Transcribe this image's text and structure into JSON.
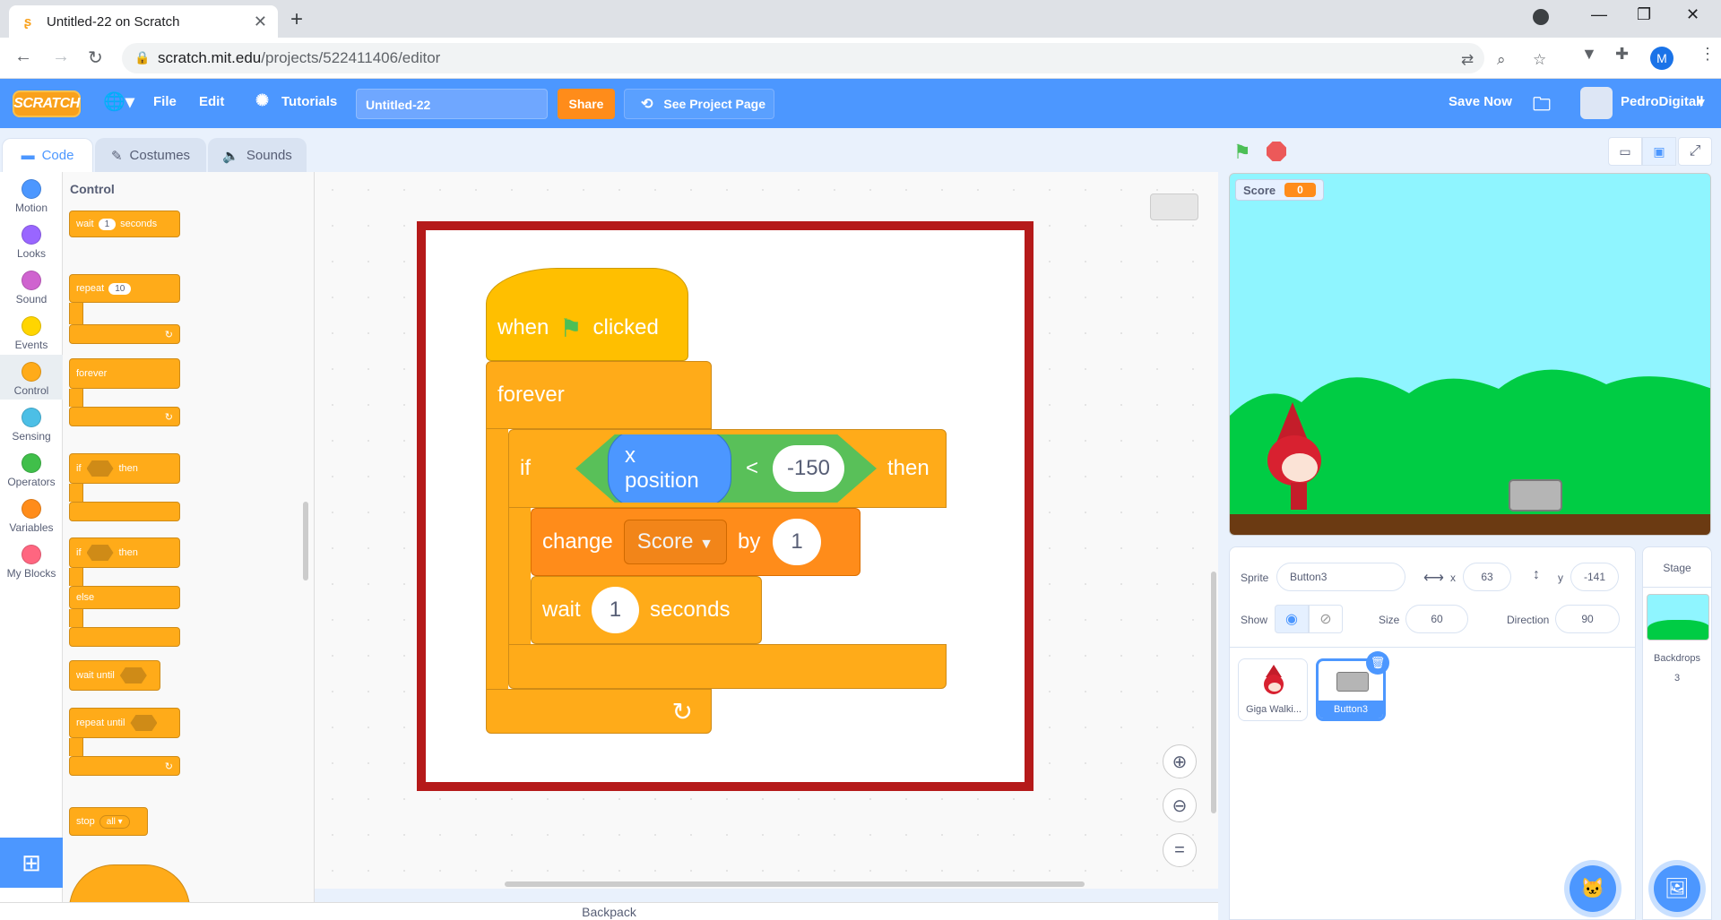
{
  "browser": {
    "tab_title": "Untitled-22 on Scratch",
    "url_host": "scratch.mit.edu",
    "url_path": "/projects/522411406/editor",
    "profile_initial": "M"
  },
  "menu": {
    "logo": "SCRATCH",
    "file": "File",
    "edit": "Edit",
    "tutorials": "Tutorials",
    "project_title": "Untitled-22",
    "share": "Share",
    "see_project": "See Project Page",
    "save_now": "Save Now",
    "username": "PedroDigitall"
  },
  "tabs": {
    "code": "Code",
    "costumes": "Costumes",
    "sounds": "Sounds"
  },
  "categories": [
    {
      "label": "Motion",
      "color": "#4c97ff"
    },
    {
      "label": "Looks",
      "color": "#9966ff"
    },
    {
      "label": "Sound",
      "color": "#cf63cf"
    },
    {
      "label": "Events",
      "color": "#ffd500"
    },
    {
      "label": "Control",
      "color": "#ffab19"
    },
    {
      "label": "Sensing",
      "color": "#4cbfe6"
    },
    {
      "label": "Operators",
      "color": "#40bf4a"
    },
    {
      "label": "Variables",
      "color": "#ff8c1a"
    },
    {
      "label": "My Blocks",
      "color": "#ff6680"
    }
  ],
  "palette": {
    "heading": "Control",
    "wait": "wait",
    "wait_val": "1",
    "seconds": "seconds",
    "repeat": "repeat",
    "repeat_val": "10",
    "forever": "forever",
    "if": "if",
    "then": "then",
    "else": "else",
    "wait_until": "wait until",
    "repeat_until": "repeat until",
    "stop": "stop",
    "stop_val": "all"
  },
  "script": {
    "when": "when",
    "clicked": "clicked",
    "forever": "forever",
    "if": "if",
    "then": "then",
    "x_position": "x position",
    "lt": "<",
    "compare_val": "-150",
    "change": "change",
    "variable": "Score",
    "by": "by",
    "change_val": "1",
    "wait": "wait",
    "wait_val": "1",
    "seconds": "seconds"
  },
  "backpack": "Backpack",
  "stage": {
    "monitor_label": "Score",
    "monitor_value": "0"
  },
  "sprite_info": {
    "sprite_label": "Sprite",
    "sprite_name": "Button3",
    "x_label": "x",
    "x": "63",
    "y_label": "y",
    "y": "-141",
    "show_label": "Show",
    "size_label": "Size",
    "size": "60",
    "direction_label": "Direction",
    "direction": "90"
  },
  "sprites": [
    {
      "name": "Giga Walki..."
    },
    {
      "name": "Button3"
    }
  ],
  "stage_panel": {
    "title": "Stage",
    "backdrops_label": "Backdrops",
    "backdrops_count": "3"
  }
}
